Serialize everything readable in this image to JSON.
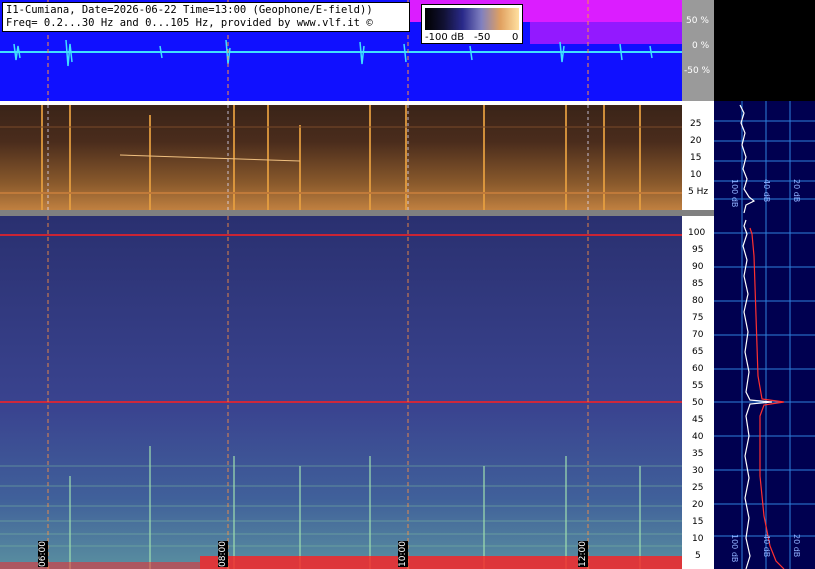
{
  "header": {
    "line1": "I1-Cumiana, Date=2026-06-22 Time=13:00 (Geophone/E-field))",
    "line2": "Freq= 0.2...30 Hz and 0...105 Hz, provided by www.vlf.it ©"
  },
  "color_legend": {
    "min_label": "-100 dB",
    "mid_label": "-50",
    "max_label": "0"
  },
  "waveform_scale": {
    "ticks": [
      "50 %",
      "0 %",
      "-50 %"
    ]
  },
  "lowfreq_scale": {
    "ticks": [
      "25",
      "20",
      "15",
      "10",
      "5 Hz"
    ]
  },
  "highfreq_scale": {
    "ticks": [
      "100",
      "95",
      "90",
      "85",
      "80",
      "75",
      "70",
      "65",
      "60",
      "55",
      "50",
      "45",
      "40",
      "35",
      "30",
      "25",
      "20",
      "15",
      "10",
      "5"
    ]
  },
  "time_markers": [
    "06:00",
    "08:00",
    "10:00",
    "12:00"
  ],
  "spectrum_panel_top": {
    "axis_labels": [
      "100 dB",
      "40 dB",
      "20 dB"
    ]
  },
  "spectrum_panel_bottom": {
    "axis_labels": [
      "100 dB",
      "40 dB",
      "20 dB"
    ]
  },
  "colors": {
    "waveform_bg": "#1010ff",
    "waveform_trace": "#40e0ff",
    "waveform_envelope": "#ff20ff",
    "panel_bg": "#000050",
    "grid": "#3aa0ff",
    "marker_line": "#ff2020"
  }
}
